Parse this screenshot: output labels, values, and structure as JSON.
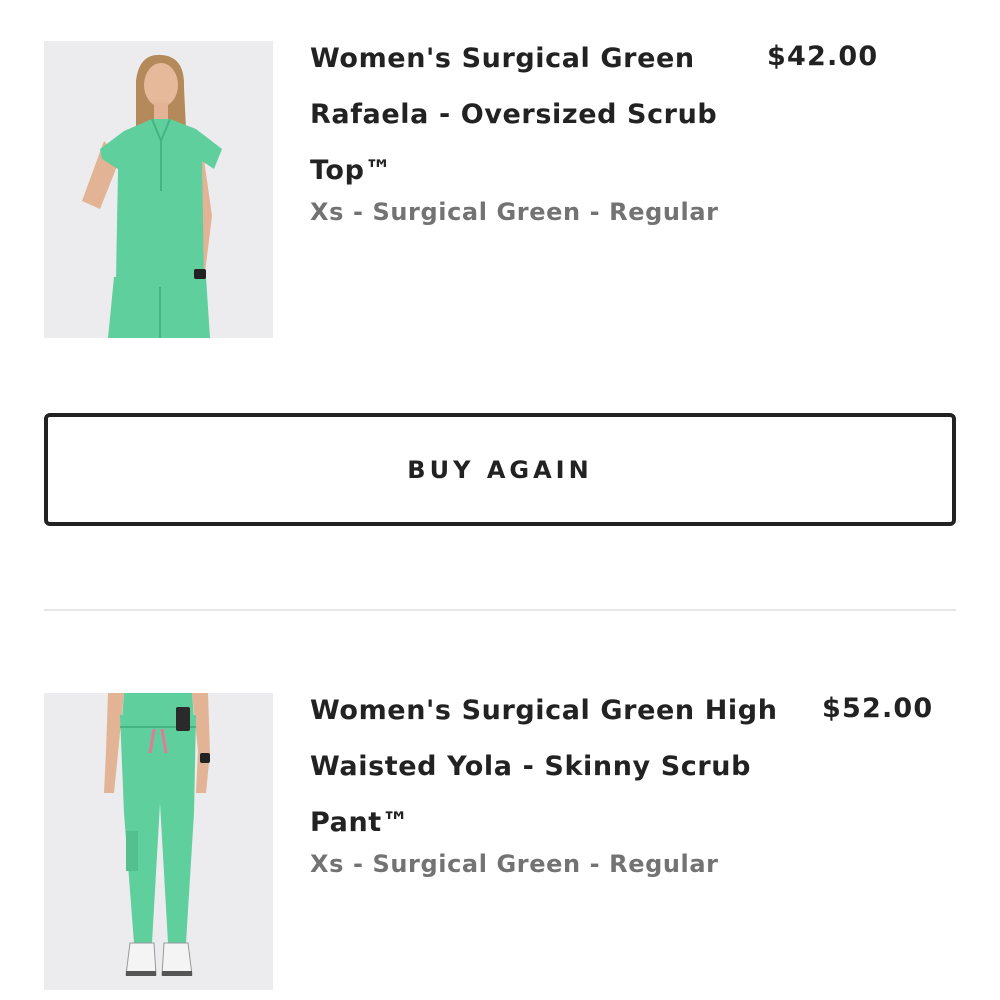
{
  "orders": [
    {
      "title": "Women's Surgical Green Rafaela - Oversized Scrub Top™",
      "variant": "Xs - Surgical Green - Regular",
      "price": "$42.00",
      "image": "model wearing surgical green oversized scrub top"
    },
    {
      "title": "Women's Surgical Green High Waisted Yola - Skinny Scrub Pant™",
      "variant": "Xs - Surgical Green - Regular",
      "price": "$52.00",
      "image": "model wearing surgical green skinny scrub pants"
    }
  ],
  "buy_again": {
    "label": "BUY AGAIN"
  },
  "colors": {
    "text": "#222222",
    "muted": "#737373",
    "scrub_green": "#5fcf9d",
    "divider": "#e6e6e6"
  }
}
